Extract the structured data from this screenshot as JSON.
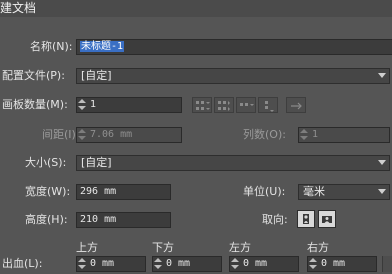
{
  "window": {
    "title": "建文档"
  },
  "fields": {
    "name": {
      "label": "名称(N):",
      "value": "未标题-1"
    },
    "profile": {
      "label": "配置文件(P):",
      "value": "[自定]"
    },
    "artboards": {
      "label": "画板数量(M):",
      "value": "1"
    },
    "spacing": {
      "label": "间距(I):",
      "value": "7.06 mm"
    },
    "columns": {
      "label": "列数(O):",
      "value": "1"
    },
    "size": {
      "label": "大小(S):",
      "value": "[自定]"
    },
    "width": {
      "label": "宽度(W):",
      "value": "296 mm"
    },
    "units": {
      "label": "单位(U):",
      "value": "毫米"
    },
    "height": {
      "label": "高度(H):",
      "value": "210 mm"
    },
    "orientation": {
      "label": "取向:"
    },
    "bleed": {
      "label": "出血(L):",
      "top": {
        "label": "上方",
        "value": "0 mm"
      },
      "bottom": {
        "label": "下方",
        "value": "0 mm"
      },
      "left": {
        "label": "左方",
        "value": "0 mm"
      },
      "right": {
        "label": "右方",
        "value": "0 mm"
      }
    }
  },
  "icons": {
    "artboard_layout": [
      "grid-by-row-icon",
      "grid-by-column-icon",
      "arrange-by-row-icon",
      "arrange-by-column-icon",
      "change-to-right-to-left-icon"
    ],
    "orientation": [
      "portrait-icon",
      "landscape-icon"
    ]
  },
  "colors": {
    "background": "#555555",
    "field": "#3c3c3c",
    "selection": "#3a6fc4"
  }
}
